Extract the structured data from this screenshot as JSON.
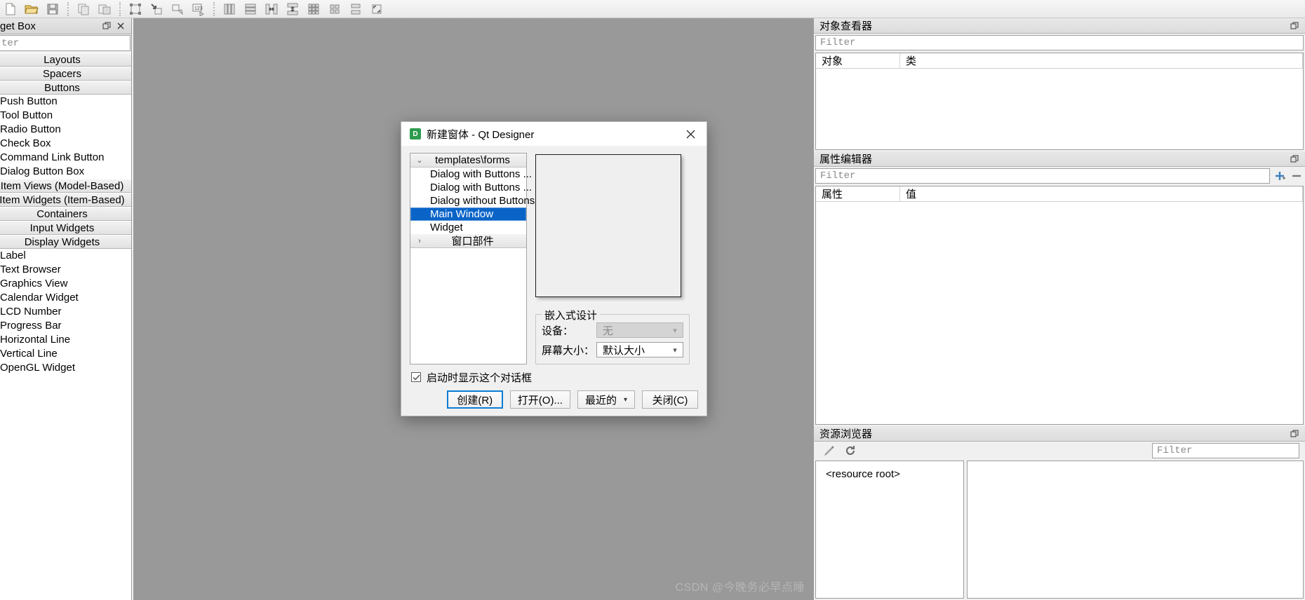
{
  "toolbar": {
    "groups": [
      {
        "name": "file",
        "buttons": [
          {
            "name": "new-form-button",
            "icon": "new-file-icon"
          },
          {
            "name": "open-form-button",
            "icon": "open-folder-icon"
          },
          {
            "name": "save-form-button",
            "icon": "save-disk-icon"
          }
        ]
      },
      {
        "name": "edit",
        "buttons": [
          {
            "name": "copy-button",
            "icon": "copy-icon"
          },
          {
            "name": "paste-button",
            "icon": "paste-icon"
          }
        ]
      },
      {
        "name": "form-tools",
        "buttons": [
          {
            "name": "edit-widgets-button",
            "icon": "edit-widgets-icon"
          },
          {
            "name": "edit-signals-slots-button",
            "icon": "signals-slots-icon"
          },
          {
            "name": "edit-buddies-button",
            "icon": "buddies-icon"
          },
          {
            "name": "edit-tab-order-button",
            "icon": "tab-order-icon"
          }
        ]
      },
      {
        "name": "layouts",
        "buttons": [
          {
            "name": "layout-horizontally-button",
            "icon": "layout-horizontal-icon"
          },
          {
            "name": "layout-vertically-button",
            "icon": "layout-vertical-icon"
          },
          {
            "name": "layout-splitter-horizontal-button",
            "icon": "splitter-horizontal-icon"
          },
          {
            "name": "layout-splitter-vertical-button",
            "icon": "splitter-vertical-icon"
          },
          {
            "name": "layout-grid-button",
            "icon": "layout-grid-icon"
          },
          {
            "name": "layout-form-button",
            "icon": "layout-form-icon"
          },
          {
            "name": "break-layout-button",
            "icon": "break-layout-icon"
          },
          {
            "name": "adjust-size-button",
            "icon": "adjust-size-icon"
          }
        ]
      }
    ]
  },
  "widget_box": {
    "title": "get Box",
    "filter_placeholder": "ter",
    "categories": [
      {
        "label": "Layouts",
        "items": []
      },
      {
        "label": "Spacers",
        "items": []
      },
      {
        "label": "Buttons",
        "items": [
          "Push Button",
          "Tool Button",
          "Radio Button",
          "Check Box",
          "Command Link Button",
          "Dialog Button Box"
        ]
      },
      {
        "label": "Item Views (Model-Based)",
        "items": []
      },
      {
        "label": "Item Widgets (Item-Based)",
        "items": []
      },
      {
        "label": "Containers",
        "items": []
      },
      {
        "label": "Input Widgets",
        "items": []
      },
      {
        "label": "Display Widgets",
        "items": [
          "Label",
          "Text Browser",
          "Graphics View",
          "Calendar Widget",
          "LCD Number",
          "Progress Bar",
          "Horizontal Line",
          "Vertical Line",
          "OpenGL Widget"
        ]
      }
    ]
  },
  "canvas": {
    "watermark": "CSDN @今晚务必早点睡"
  },
  "object_inspector": {
    "title": "对象查看器",
    "filter_placeholder": "Filter",
    "columns": [
      "对象",
      "类"
    ],
    "rows": []
  },
  "property_editor": {
    "title": "属性编辑器",
    "filter_placeholder": "Filter",
    "columns": [
      "属性",
      "值"
    ],
    "rows": []
  },
  "resource_browser": {
    "title": "资源浏览器",
    "filter_placeholder": "Filter",
    "root_label": "<resource root>"
  },
  "dialog": {
    "title": "新建窗体 - Qt Designer",
    "icon_letter": "D",
    "tree": [
      {
        "type": "group",
        "label": "templates\\forms",
        "expanded": true
      },
      {
        "type": "item",
        "label": "Dialog with Buttons ...",
        "selected": false
      },
      {
        "type": "item",
        "label": "Dialog with Buttons ...",
        "selected": false
      },
      {
        "type": "item",
        "label": "Dialog without Buttons",
        "selected": false
      },
      {
        "type": "item",
        "label": "Main Window",
        "selected": true
      },
      {
        "type": "item",
        "label": "Widget",
        "selected": false
      },
      {
        "type": "group",
        "label": "窗口部件",
        "expanded": false
      }
    ],
    "embedded": {
      "title": "嵌入式设计",
      "device_label": "设备：",
      "device_value": "无",
      "device_disabled": true,
      "screen_label": "屏幕大小：",
      "screen_value": "默认大小"
    },
    "show_on_startup": {
      "label": "启动时显示这个对话框",
      "checked": true
    },
    "buttons": {
      "create": "创建(R)",
      "open": "打开(O)...",
      "recent": "最近的",
      "close": "关闭(C)"
    }
  },
  "colors": {
    "selection": "#0a64c8",
    "default_button_border": "#0a7cd4",
    "canvas": "#999999",
    "app_icon": "#2d9b4e"
  }
}
